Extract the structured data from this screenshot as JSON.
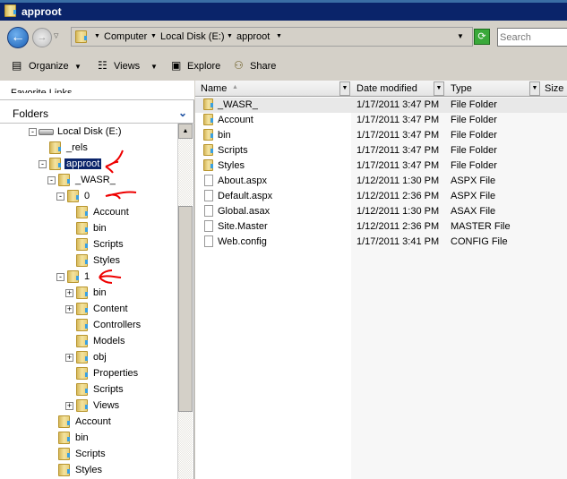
{
  "window": {
    "title": "approot"
  },
  "address": {
    "crumbs": [
      "Computer",
      "Local Disk (E:)",
      "approot"
    ],
    "search_placeholder": "Search"
  },
  "toolbar": {
    "organize": "Organize",
    "views": "Views",
    "explore": "Explore",
    "share": "Share"
  },
  "left_pane": {
    "favorites_label": "Favorite Links",
    "folders_label": "Folders",
    "tree": [
      {
        "label": "Local Disk (E:)",
        "level": 0,
        "expander": "-",
        "icon": "drive-icon"
      },
      {
        "label": "_rels",
        "level": 1,
        "expander": ""
      },
      {
        "label": "approot",
        "level": 1,
        "expander": "-",
        "selected": true
      },
      {
        "label": "_WASR_",
        "level": 2,
        "expander": "-"
      },
      {
        "label": "0",
        "level": 3,
        "expander": "-"
      },
      {
        "label": "Account",
        "level": 4,
        "expander": ""
      },
      {
        "label": "bin",
        "level": 4,
        "expander": ""
      },
      {
        "label": "Scripts",
        "level": 4,
        "expander": ""
      },
      {
        "label": "Styles",
        "level": 4,
        "expander": ""
      },
      {
        "label": "1",
        "level": 3,
        "expander": "-"
      },
      {
        "label": "bin",
        "level": 4,
        "expander": "+"
      },
      {
        "label": "Content",
        "level": 4,
        "expander": "+"
      },
      {
        "label": "Controllers",
        "level": 4,
        "expander": ""
      },
      {
        "label": "Models",
        "level": 4,
        "expander": ""
      },
      {
        "label": "obj",
        "level": 4,
        "expander": "+"
      },
      {
        "label": "Properties",
        "level": 4,
        "expander": ""
      },
      {
        "label": "Scripts",
        "level": 4,
        "expander": ""
      },
      {
        "label": "Views",
        "level": 4,
        "expander": "+"
      },
      {
        "label": "Account",
        "level": 2,
        "expander": ""
      },
      {
        "label": "bin",
        "level": 2,
        "expander": ""
      },
      {
        "label": "Scripts",
        "level": 2,
        "expander": ""
      },
      {
        "label": "Styles",
        "level": 2,
        "expander": ""
      }
    ]
  },
  "file_list": {
    "columns": [
      "Name",
      "Date modified",
      "Type",
      "Size"
    ],
    "rows": [
      {
        "name": "_WASR_",
        "date": "1/17/2011 3:47 PM",
        "type": "File Folder",
        "folder": true
      },
      {
        "name": "Account",
        "date": "1/17/2011 3:47 PM",
        "type": "File Folder",
        "folder": true
      },
      {
        "name": "bin",
        "date": "1/17/2011 3:47 PM",
        "type": "File Folder",
        "folder": true
      },
      {
        "name": "Scripts",
        "date": "1/17/2011 3:47 PM",
        "type": "File Folder",
        "folder": true
      },
      {
        "name": "Styles",
        "date": "1/17/2011 3:47 PM",
        "type": "File Folder",
        "folder": true
      },
      {
        "name": "About.aspx",
        "date": "1/12/2011 1:30 PM",
        "type": "ASPX File",
        "folder": false
      },
      {
        "name": "Default.aspx",
        "date": "1/12/2011 2:36 PM",
        "type": "ASPX File",
        "folder": false
      },
      {
        "name": "Global.asax",
        "date": "1/12/2011 1:30 PM",
        "type": "ASAX File",
        "folder": false
      },
      {
        "name": "Site.Master",
        "date": "1/12/2011 2:36 PM",
        "type": "MASTER File",
        "folder": false
      },
      {
        "name": "Web.config",
        "date": "1/17/2011 3:41 PM",
        "type": "CONFIG File",
        "folder": false
      }
    ]
  }
}
